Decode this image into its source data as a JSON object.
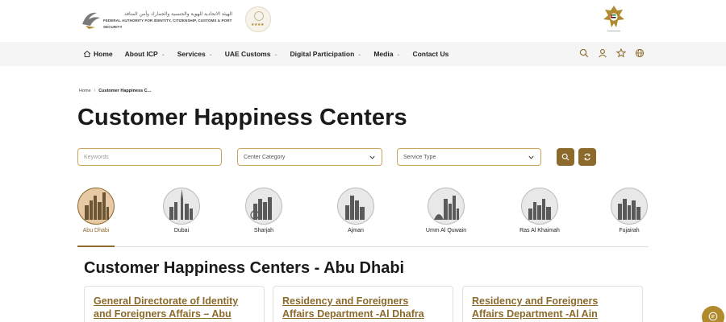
{
  "brand": {
    "arabic_name": "الهيئة الاتحادية للهوية والجنسية والجمارك وأمن المنافذ",
    "english_name": "FEDERAL AUTHORITY FOR IDENTITY, CITIZENSHIP, CUSTOMS & PORT SECURITY",
    "rating_stars": "★★★★"
  },
  "nav": {
    "items": [
      {
        "label": "Home",
        "has_dropdown": false
      },
      {
        "label": "About ICP",
        "has_dropdown": true
      },
      {
        "label": "Services",
        "has_dropdown": true
      },
      {
        "label": "UAE Customs",
        "has_dropdown": true
      },
      {
        "label": "Digital Participation",
        "has_dropdown": true
      },
      {
        "label": "Media",
        "has_dropdown": true
      },
      {
        "label": "Contact Us",
        "has_dropdown": false
      }
    ],
    "tools": [
      "search-icon",
      "user-icon",
      "star-icon",
      "globe-icon"
    ]
  },
  "breadcrumb": {
    "home": "Home",
    "separator": "/",
    "current": "Customer Happiness C..."
  },
  "page_title": "Customer Happiness Centers",
  "filters": {
    "keywords_placeholder": "Keywords",
    "center_category": "Center Category",
    "service_type": "Service Type"
  },
  "cities": [
    {
      "label": "Abu Dhabi",
      "active": true
    },
    {
      "label": "Dubai",
      "active": false
    },
    {
      "label": "Sharjah",
      "active": false
    },
    {
      "label": "Ajman",
      "active": false
    },
    {
      "label": "Umm Al Quwain",
      "active": false
    },
    {
      "label": "Ras Al Khaimah",
      "active": false
    },
    {
      "label": "Fujairah",
      "active": false
    }
  ],
  "section_title": "Customer Happiness Centers - Abu Dhabi",
  "cards": [
    {
      "line1": "General Directorate of Identity",
      "line2": "and Foreigners Affairs – Abu"
    },
    {
      "line1": "Residency and Foreigners",
      "line2": "Affairs Department -Al Dhafra"
    },
    {
      "line1": "Residency and Foreigners",
      "line2": "Affairs Department -Al Ain"
    }
  ],
  "colors": {
    "accent": "#8b6a2c",
    "gold": "#b08a2c",
    "field_border": "#c9a45c",
    "nav_bg": "#f5f5f5"
  }
}
